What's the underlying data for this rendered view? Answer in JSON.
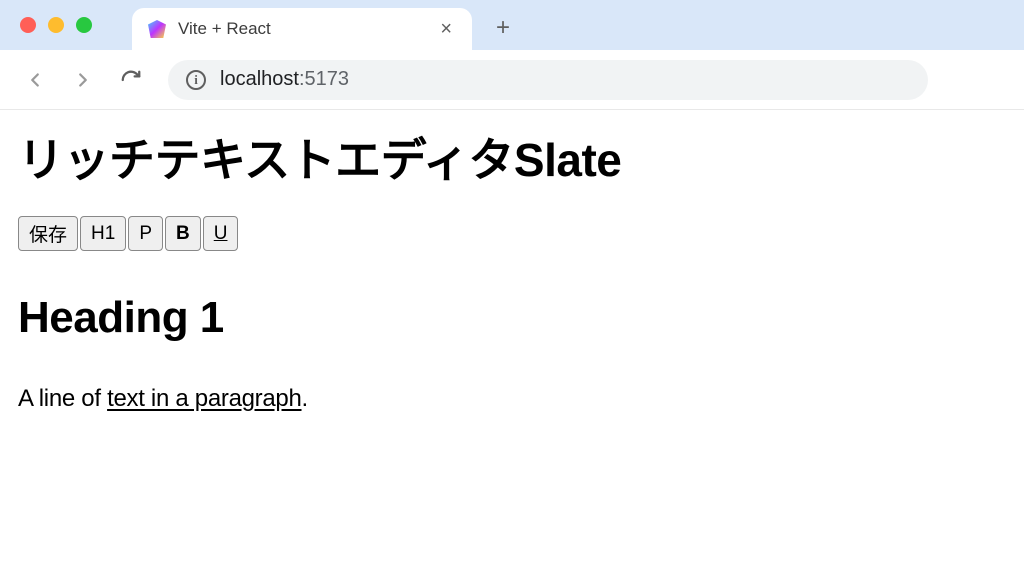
{
  "browser": {
    "tab": {
      "title": "Vite + React"
    },
    "url": {
      "host": "localhost",
      "port": ":5173"
    }
  },
  "page": {
    "title": "リッチテキストエディタSlate"
  },
  "toolbar": {
    "save": "保存",
    "h1": "H1",
    "p": "P",
    "bold": "B",
    "underline": "U"
  },
  "editor": {
    "heading": "Heading 1",
    "paragraph": {
      "before": "A line of ",
      "underlined": "text in a paragraph",
      "after": "."
    }
  }
}
